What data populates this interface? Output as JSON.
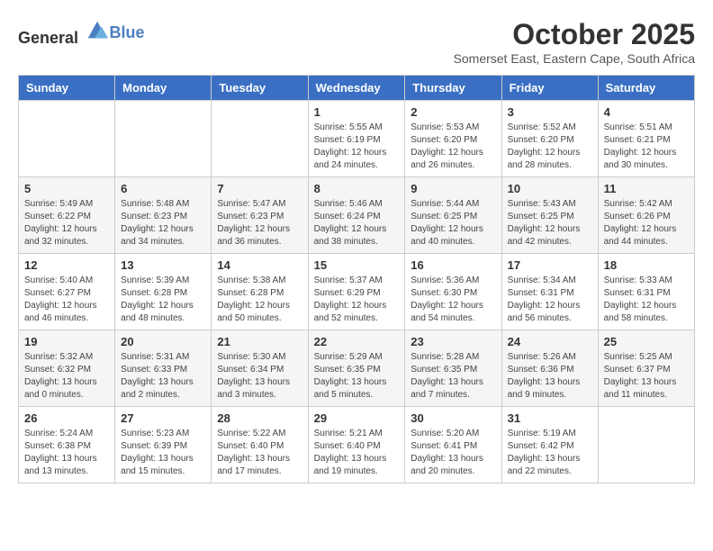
{
  "header": {
    "logo_general": "General",
    "logo_blue": "Blue",
    "month_title": "October 2025",
    "location": "Somerset East, Eastern Cape, South Africa"
  },
  "days_of_week": [
    "Sunday",
    "Monday",
    "Tuesday",
    "Wednesday",
    "Thursday",
    "Friday",
    "Saturday"
  ],
  "weeks": [
    [
      {
        "day": "",
        "info": ""
      },
      {
        "day": "",
        "info": ""
      },
      {
        "day": "",
        "info": ""
      },
      {
        "day": "1",
        "info": "Sunrise: 5:55 AM\nSunset: 6:19 PM\nDaylight: 12 hours and 24 minutes."
      },
      {
        "day": "2",
        "info": "Sunrise: 5:53 AM\nSunset: 6:20 PM\nDaylight: 12 hours and 26 minutes."
      },
      {
        "day": "3",
        "info": "Sunrise: 5:52 AM\nSunset: 6:20 PM\nDaylight: 12 hours and 28 minutes."
      },
      {
        "day": "4",
        "info": "Sunrise: 5:51 AM\nSunset: 6:21 PM\nDaylight: 12 hours and 30 minutes."
      }
    ],
    [
      {
        "day": "5",
        "info": "Sunrise: 5:49 AM\nSunset: 6:22 PM\nDaylight: 12 hours and 32 minutes."
      },
      {
        "day": "6",
        "info": "Sunrise: 5:48 AM\nSunset: 6:23 PM\nDaylight: 12 hours and 34 minutes."
      },
      {
        "day": "7",
        "info": "Sunrise: 5:47 AM\nSunset: 6:23 PM\nDaylight: 12 hours and 36 minutes."
      },
      {
        "day": "8",
        "info": "Sunrise: 5:46 AM\nSunset: 6:24 PM\nDaylight: 12 hours and 38 minutes."
      },
      {
        "day": "9",
        "info": "Sunrise: 5:44 AM\nSunset: 6:25 PM\nDaylight: 12 hours and 40 minutes."
      },
      {
        "day": "10",
        "info": "Sunrise: 5:43 AM\nSunset: 6:25 PM\nDaylight: 12 hours and 42 minutes."
      },
      {
        "day": "11",
        "info": "Sunrise: 5:42 AM\nSunset: 6:26 PM\nDaylight: 12 hours and 44 minutes."
      }
    ],
    [
      {
        "day": "12",
        "info": "Sunrise: 5:40 AM\nSunset: 6:27 PM\nDaylight: 12 hours and 46 minutes."
      },
      {
        "day": "13",
        "info": "Sunrise: 5:39 AM\nSunset: 6:28 PM\nDaylight: 12 hours and 48 minutes."
      },
      {
        "day": "14",
        "info": "Sunrise: 5:38 AM\nSunset: 6:28 PM\nDaylight: 12 hours and 50 minutes."
      },
      {
        "day": "15",
        "info": "Sunrise: 5:37 AM\nSunset: 6:29 PM\nDaylight: 12 hours and 52 minutes."
      },
      {
        "day": "16",
        "info": "Sunrise: 5:36 AM\nSunset: 6:30 PM\nDaylight: 12 hours and 54 minutes."
      },
      {
        "day": "17",
        "info": "Sunrise: 5:34 AM\nSunset: 6:31 PM\nDaylight: 12 hours and 56 minutes."
      },
      {
        "day": "18",
        "info": "Sunrise: 5:33 AM\nSunset: 6:31 PM\nDaylight: 12 hours and 58 minutes."
      }
    ],
    [
      {
        "day": "19",
        "info": "Sunrise: 5:32 AM\nSunset: 6:32 PM\nDaylight: 13 hours and 0 minutes."
      },
      {
        "day": "20",
        "info": "Sunrise: 5:31 AM\nSunset: 6:33 PM\nDaylight: 13 hours and 2 minutes."
      },
      {
        "day": "21",
        "info": "Sunrise: 5:30 AM\nSunset: 6:34 PM\nDaylight: 13 hours and 3 minutes."
      },
      {
        "day": "22",
        "info": "Sunrise: 5:29 AM\nSunset: 6:35 PM\nDaylight: 13 hours and 5 minutes."
      },
      {
        "day": "23",
        "info": "Sunrise: 5:28 AM\nSunset: 6:35 PM\nDaylight: 13 hours and 7 minutes."
      },
      {
        "day": "24",
        "info": "Sunrise: 5:26 AM\nSunset: 6:36 PM\nDaylight: 13 hours and 9 minutes."
      },
      {
        "day": "25",
        "info": "Sunrise: 5:25 AM\nSunset: 6:37 PM\nDaylight: 13 hours and 11 minutes."
      }
    ],
    [
      {
        "day": "26",
        "info": "Sunrise: 5:24 AM\nSunset: 6:38 PM\nDaylight: 13 hours and 13 minutes."
      },
      {
        "day": "27",
        "info": "Sunrise: 5:23 AM\nSunset: 6:39 PM\nDaylight: 13 hours and 15 minutes."
      },
      {
        "day": "28",
        "info": "Sunrise: 5:22 AM\nSunset: 6:40 PM\nDaylight: 13 hours and 17 minutes."
      },
      {
        "day": "29",
        "info": "Sunrise: 5:21 AM\nSunset: 6:40 PM\nDaylight: 13 hours and 19 minutes."
      },
      {
        "day": "30",
        "info": "Sunrise: 5:20 AM\nSunset: 6:41 PM\nDaylight: 13 hours and 20 minutes."
      },
      {
        "day": "31",
        "info": "Sunrise: 5:19 AM\nSunset: 6:42 PM\nDaylight: 13 hours and 22 minutes."
      },
      {
        "day": "",
        "info": ""
      }
    ]
  ]
}
